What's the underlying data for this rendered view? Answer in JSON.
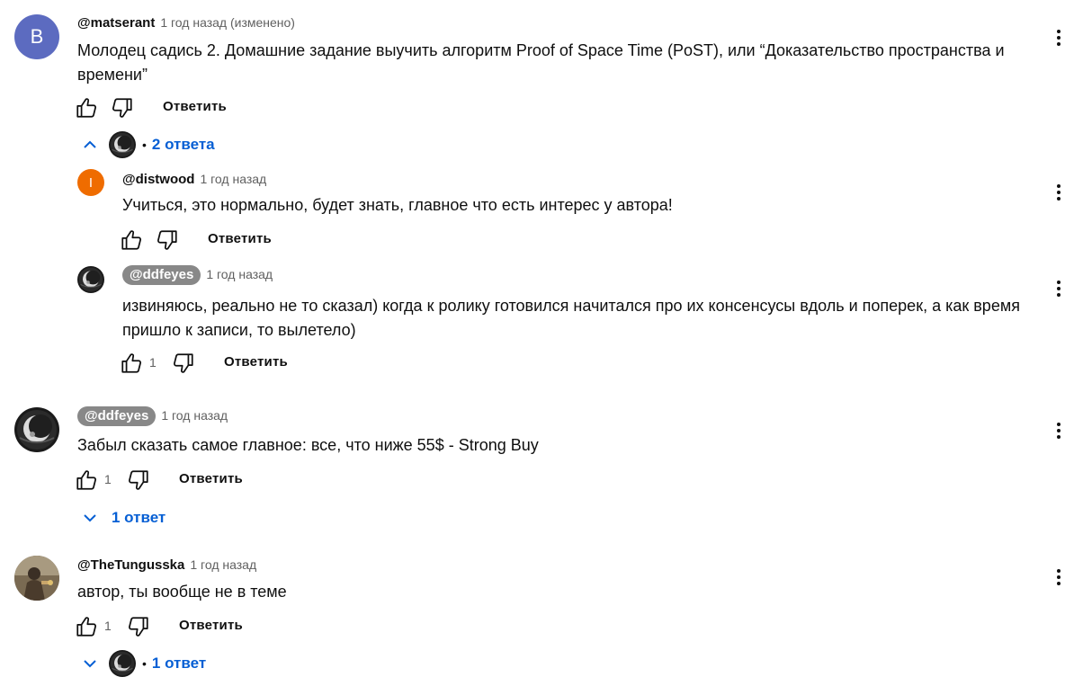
{
  "icons": {
    "like": "thumbs-up-icon",
    "dislike": "thumbs-down-icon",
    "menu": "more-vert-icon",
    "expand": "chevron-icon"
  },
  "colors": {
    "link_blue": "#065fd4",
    "avatar_b": "#5c6bc0",
    "avatar_i": "#ef6c00",
    "chip_bg": "#888888"
  },
  "comments": [
    {
      "avatar_letter": "B",
      "author": "@matserant",
      "time": "1 год назад (изменено)",
      "text_line1": "Молодец садись 2. Домашние задание выучить алгоритм Proof of Space Time (PoST), или “Доказательство пространства и",
      "text_line2": "времени”",
      "reply_label": "Ответить",
      "replies_toggle": "2 ответа",
      "replies": [
        {
          "avatar_letter": "I",
          "author": "@distwood",
          "time": "1 год назад",
          "text": "Учиться, это нормально, будет знать, главное что есть интерес у автора!",
          "reply_label": "Ответить"
        },
        {
          "author": "@ddfeyes",
          "time": "1 год назад",
          "text_line1": "извиняюсь, реально не то сказал) когда к ролику готовился начитался про их консенсусы вдоль и поперек, а как время",
          "text_line2": "пришло к записи, то вылетело)",
          "likes": "1",
          "reply_label": "Ответить"
        }
      ]
    },
    {
      "author": "@ddfeyes",
      "time": "1 год назад",
      "text": "Забыл сказать самое главное: все, что ниже 55$ - Strong Buy",
      "likes": "1",
      "reply_label": "Ответить",
      "replies_toggle": "1 ответ"
    },
    {
      "author": "@TheTungusska",
      "time": "1 год назад",
      "text": "автор, ты вообще не в теме",
      "likes": "1",
      "reply_label": "Ответить",
      "replies_toggle": "1 ответ"
    }
  ]
}
